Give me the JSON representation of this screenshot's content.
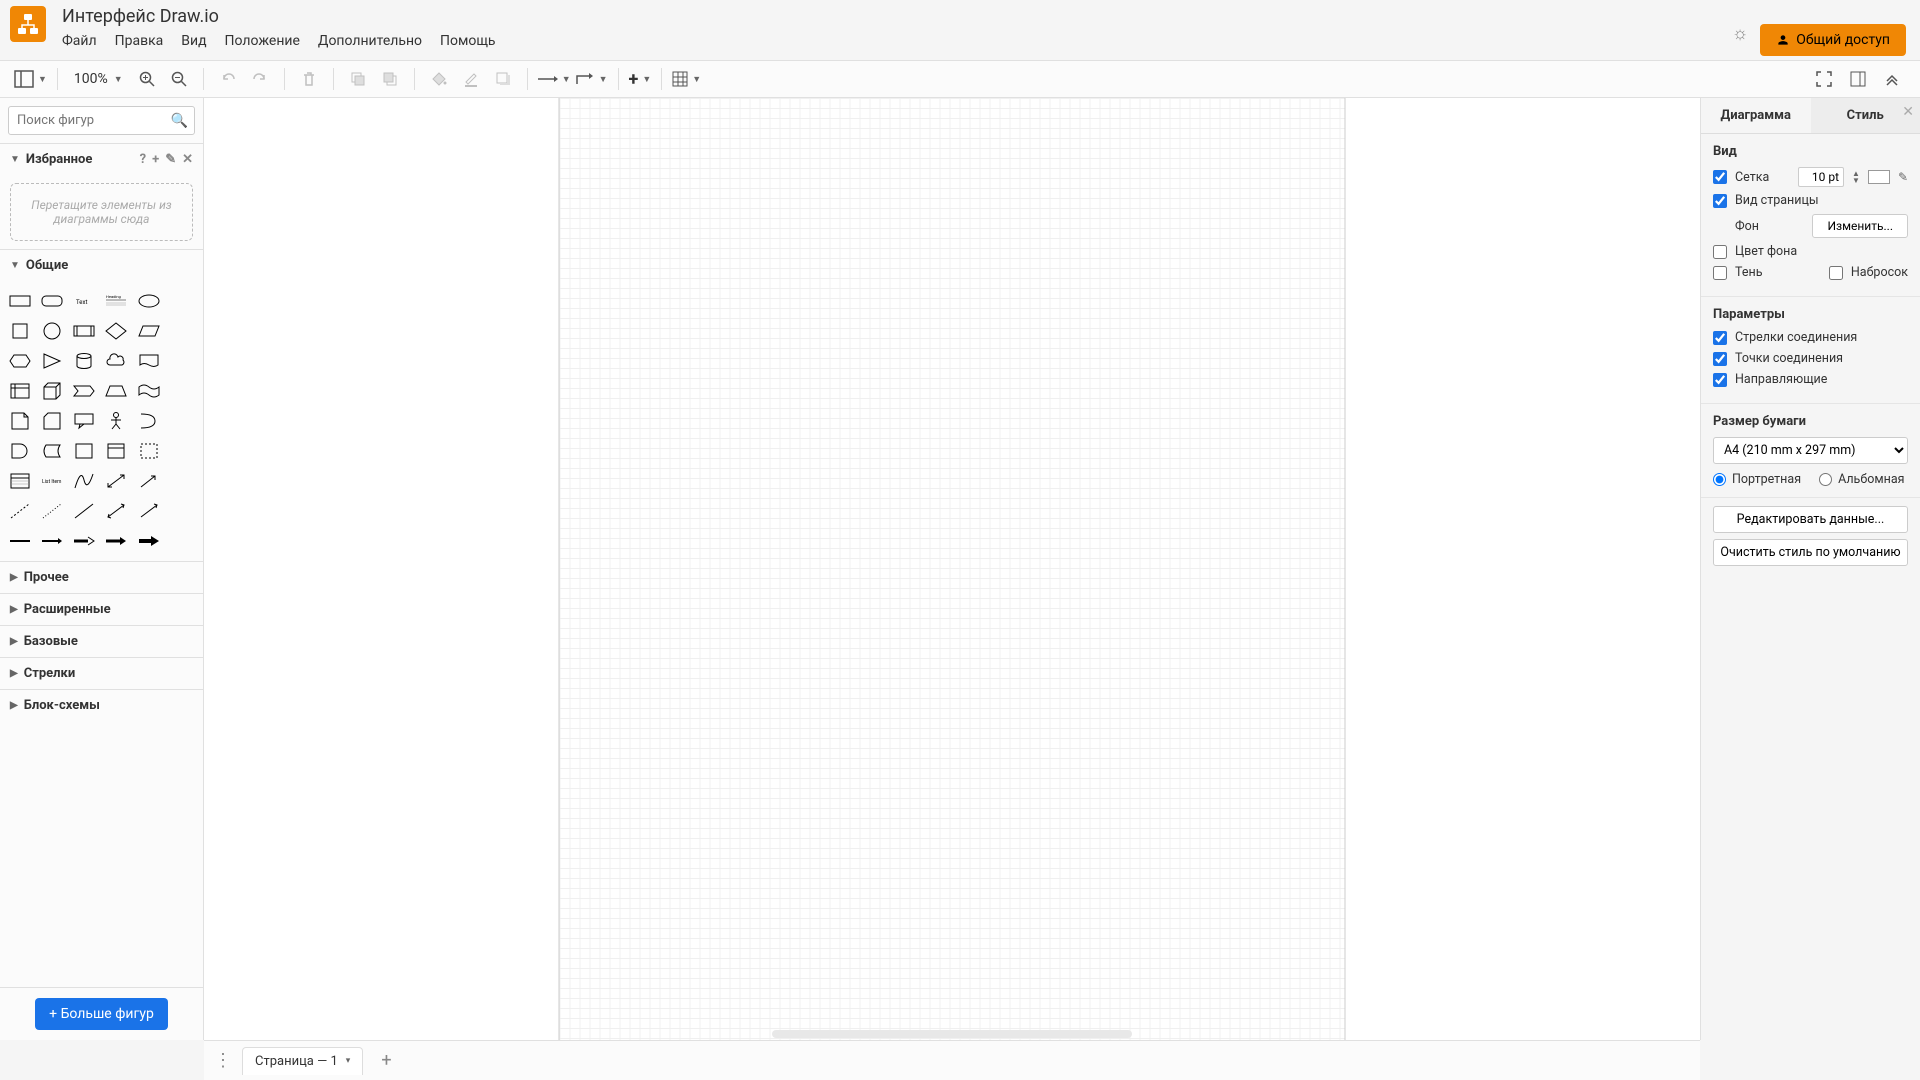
{
  "header": {
    "title": "Интерфейс Draw.io",
    "menu": [
      "Файл",
      "Правка",
      "Вид",
      "Положение",
      "Дополнительно",
      "Помощь"
    ],
    "share_label": "Общий доступ"
  },
  "toolbar": {
    "zoom": "100%"
  },
  "sidebar": {
    "search_placeholder": "Поиск фигур",
    "sections": {
      "favorites": {
        "title": "Избранное",
        "drop_hint": "Перетащите элементы из диаграммы сюда"
      },
      "general": {
        "title": "Общие"
      },
      "more_categories": [
        "Прочее",
        "Расширенные",
        "Базовые",
        "Стрелки",
        "Блок-схемы"
      ]
    },
    "more_shapes": "+ Больше фигур"
  },
  "right_panel": {
    "tabs": [
      "Диаграмма",
      "Стиль"
    ],
    "view": {
      "title": "Вид",
      "grid_label": "Сетка",
      "grid_size": "10 pt",
      "page_view_label": "Вид страницы",
      "background_label": "Фон",
      "change_label": "Изменить...",
      "bg_color_label": "Цвет фона",
      "shadow_label": "Тень",
      "sketch_label": "Набросок"
    },
    "options": {
      "title": "Параметры",
      "connection_arrows": "Стрелки соединения",
      "connection_points": "Точки соединения",
      "guides": "Направляющие"
    },
    "paper": {
      "title": "Размер бумаги",
      "selected": "A4 (210 mm x 297 mm)",
      "portrait": "Портретная",
      "landscape": "Альбомная"
    },
    "edit_data": "Редактировать данные...",
    "reset_style": "Очистить стиль по умолчанию"
  },
  "footer": {
    "page_label": "Страница — 1"
  }
}
